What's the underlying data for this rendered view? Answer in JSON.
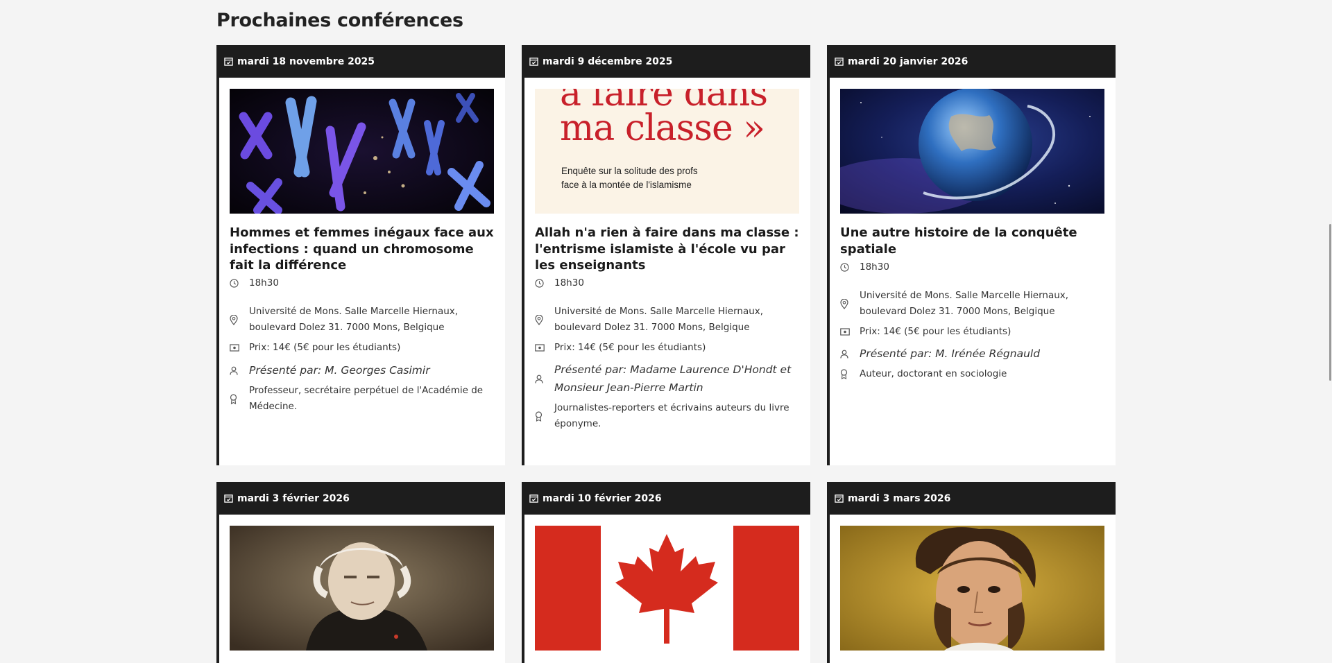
{
  "section_title": "Prochaines conférences",
  "cards": [
    {
      "date": "mardi 18 novembre 2025",
      "image": "chromosomes",
      "title": "Hommes et femmes inégaux face aux infections : quand un chromosome fait la différence",
      "time": "18h30",
      "location": "Université de Mons. Salle Marcelle Hiernaux, boulevard Dolez 31. 7000 Mons, Belgique",
      "price": "Prix: 14€ (5€ pour les étudiants)",
      "presenter": "Présenté par: M. Georges Casimir",
      "bio": "Professeur, secrétaire perpétuel de l'Académie de Médecine."
    },
    {
      "date": "mardi 9 décembre 2025",
      "image": "book-cover",
      "image_text": {
        "line1": "à faire dans",
        "line2": "ma classe »",
        "sub1": "Enquête sur la solitude des profs",
        "sub2": "face à la montée de l'islamisme"
      },
      "title": "Allah n'a rien à faire dans ma classe : l'entrisme islamiste à l'école vu par les enseignants",
      "time": "18h30",
      "location": "Université de Mons. Salle Marcelle Hiernaux, boulevard Dolez 31. 7000 Mons, Belgique",
      "price": "Prix: 14€ (5€ pour les étudiants)",
      "presenter": "Présenté par: Madame Laurence D'Hondt et Monsieur Jean-Pierre Martin",
      "bio": "Journalistes-reporters et écrivains auteurs du livre éponyme."
    },
    {
      "date": "mardi 20 janvier 2026",
      "image": "earth",
      "title": "Une autre histoire de la conquête spatiale",
      "time": "18h30",
      "location": "Université de Mons. Salle Marcelle Hiernaux, boulevard Dolez 31. 7000 Mons, Belgique",
      "price": "Prix: 14€ (5€ pour les étudiants)",
      "presenter": "Présenté par: M. Irénée Régnauld",
      "bio": "Auteur, doctorant en sociologie"
    },
    {
      "date": "mardi 3 février 2026",
      "image": "portrait-old-man"
    },
    {
      "date": "mardi 10 février 2026",
      "image": "canada-flag"
    },
    {
      "date": "mardi 3 mars 2026",
      "image": "portrait-painting"
    }
  ],
  "colors": {
    "page_bg": "#f4f4f4",
    "card_header": "#1d1d1d",
    "flag_red": "#d52b1e",
    "book_red": "#c8202a",
    "book_bg": "#fbf3e6"
  }
}
